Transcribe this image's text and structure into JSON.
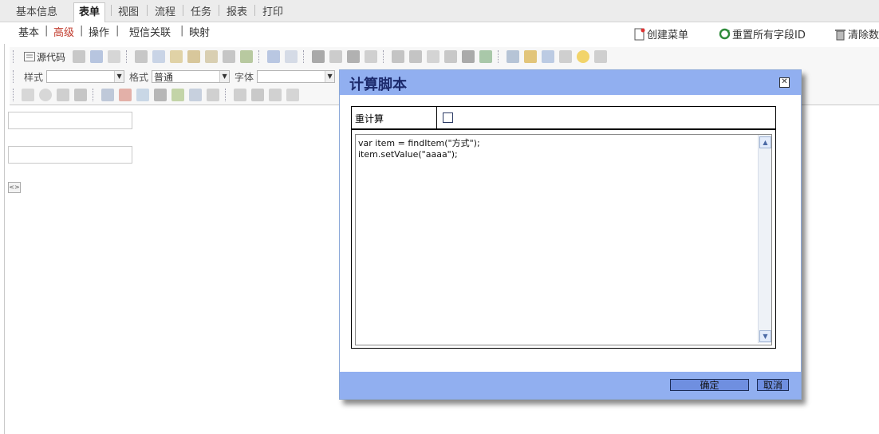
{
  "tabs": {
    "basic": "基本信息",
    "form": "表单",
    "view": "视图",
    "flow": "流程",
    "task": "任务",
    "report": "报表",
    "print": "打印"
  },
  "subnav": {
    "basic": "基本",
    "advanced": "高级",
    "operations": "操作",
    "sms": "短信关联",
    "mapping": "映射",
    "sep": "|"
  },
  "actions": {
    "create_menu": "创建菜单",
    "reset_ids": "重置所有字段ID",
    "clear_data": "清除数"
  },
  "toolbar": {
    "source": "源代码",
    "style_label": "样式",
    "style_value": "",
    "format_label": "格式",
    "format_value": "普通",
    "font_label": "字体",
    "font_value": ""
  },
  "dialog": {
    "title": "计算脚本",
    "recalc_label": "重计算",
    "recalc_checked": false,
    "script": "var item = findItem(\"方式\");\nitem.setValue(\"aaaa\");",
    "ok": "确定",
    "cancel": "取消"
  }
}
